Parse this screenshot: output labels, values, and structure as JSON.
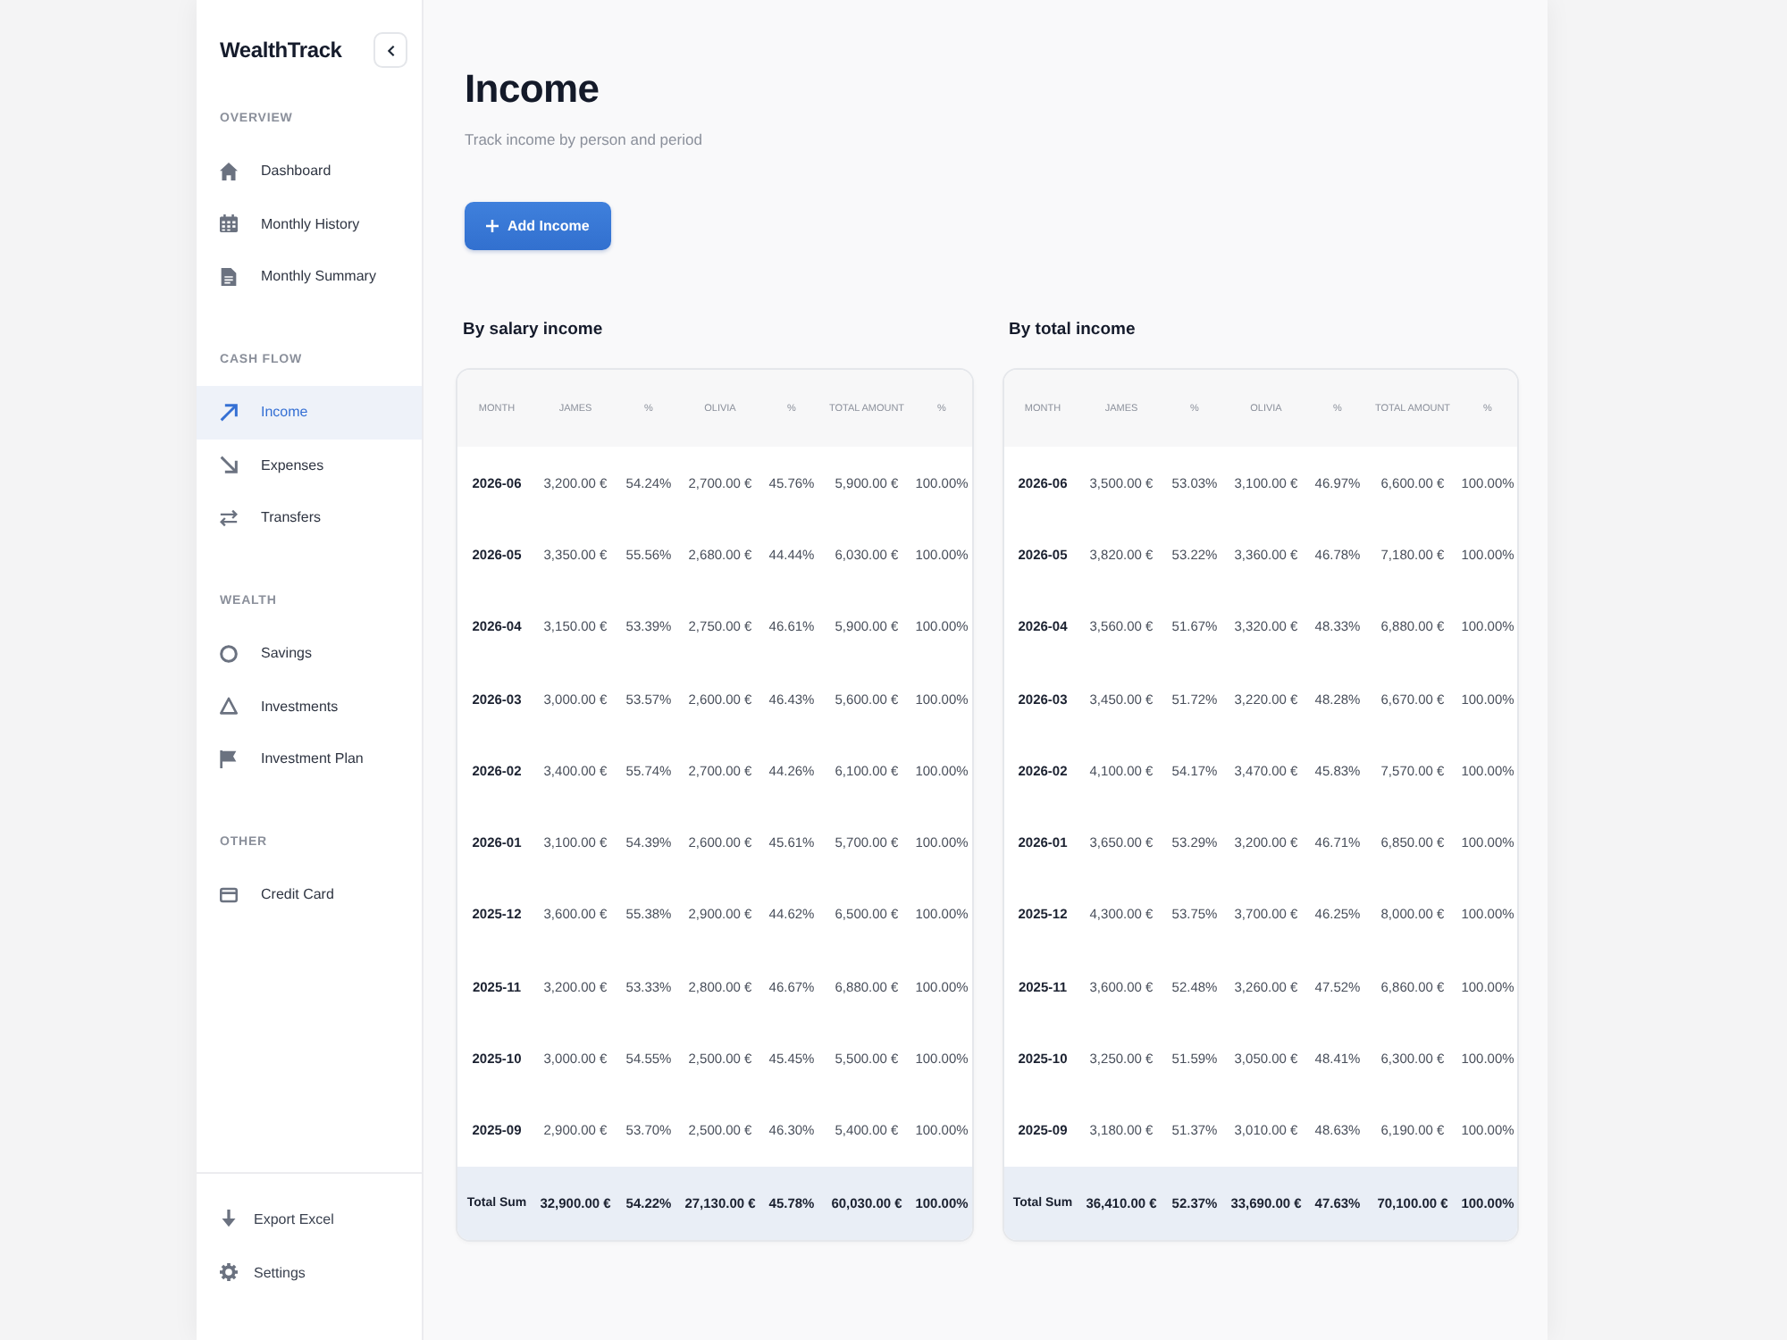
{
  "sidebar": {
    "brand": "WealthTrack",
    "sections": [
      {
        "label": "OVERVIEW",
        "items": [
          {
            "label": "Dashboard",
            "selected": false
          },
          {
            "label": "Monthly History",
            "selected": false
          },
          {
            "label": "Monthly Summary",
            "selected": false
          }
        ]
      },
      {
        "label": "CASH FLOW",
        "items": [
          {
            "label": "Income",
            "selected": true
          },
          {
            "label": "Expenses",
            "selected": false
          },
          {
            "label": "Transfers",
            "selected": false
          }
        ]
      },
      {
        "label": "WEALTH",
        "items": [
          {
            "label": "Savings",
            "selected": false
          },
          {
            "label": "Investments",
            "selected": false
          },
          {
            "label": "Investment Plan",
            "selected": false
          }
        ]
      },
      {
        "label": "OTHER",
        "items": [
          {
            "label": "Credit Card",
            "selected": false
          }
        ]
      }
    ],
    "footer_items": [
      {
        "label": "Export Excel"
      },
      {
        "label": "Settings"
      }
    ]
  },
  "header": {
    "title": "Income",
    "subtitle": "Track income by person and period",
    "add_button": "Add Income"
  },
  "tables": [
    {
      "title": "By salary income",
      "columns": [
        "MONTH",
        "JAMES",
        "%",
        "OLIVIA",
        "%",
        "TOTAL AMOUNT",
        "%"
      ],
      "rows": [
        [
          "2026-06",
          "3,200.00 €",
          "54.24%",
          "2,700.00 €",
          "45.76%",
          "5,900.00 €",
          "100.00%"
        ],
        [
          "2026-05",
          "3,350.00 €",
          "55.56%",
          "2,680.00 €",
          "44.44%",
          "6,030.00 €",
          "100.00%"
        ],
        [
          "2026-04",
          "3,150.00 €",
          "53.39%",
          "2,750.00 €",
          "46.61%",
          "5,900.00 €",
          "100.00%"
        ],
        [
          "2026-03",
          "3,000.00 €",
          "53.57%",
          "2,600.00 €",
          "46.43%",
          "5,600.00 €",
          "100.00%"
        ],
        [
          "2026-02",
          "3,400.00 €",
          "55.74%",
          "2,700.00 €",
          "44.26%",
          "6,100.00 €",
          "100.00%"
        ],
        [
          "2026-01",
          "3,100.00 €",
          "54.39%",
          "2,600.00 €",
          "45.61%",
          "5,700.00 €",
          "100.00%"
        ],
        [
          "2025-12",
          "3,600.00 €",
          "55.38%",
          "2,900.00 €",
          "44.62%",
          "6,500.00 €",
          "100.00%"
        ],
        [
          "2025-11",
          "3,200.00 €",
          "53.33%",
          "2,800.00 €",
          "46.67%",
          "6,880.00 €",
          "100.00%"
        ],
        [
          "2025-10",
          "3,000.00 €",
          "54.55%",
          "2,500.00 €",
          "45.45%",
          "5,500.00 €",
          "100.00%"
        ],
        [
          "2025-09",
          "2,900.00 €",
          "53.70%",
          "2,500.00 €",
          "46.30%",
          "5,400.00 €",
          "100.00%"
        ]
      ],
      "total_row": [
        "Total Sum",
        "32,900.00 €",
        "54.22%",
        "27,130.00 €",
        "45.78%",
        "60,030.00 €",
        "100.00%"
      ]
    },
    {
      "title": "By total income",
      "columns": [
        "MONTH",
        "JAMES",
        "%",
        "OLIVIA",
        "%",
        "TOTAL AMOUNT",
        "%"
      ],
      "rows": [
        [
          "2026-06",
          "3,500.00 €",
          "53.03%",
          "3,100.00 €",
          "46.97%",
          "6,600.00 €",
          "100.00%"
        ],
        [
          "2026-05",
          "3,820.00 €",
          "53.22%",
          "3,360.00 €",
          "46.78%",
          "7,180.00 €",
          "100.00%"
        ],
        [
          "2026-04",
          "3,560.00 €",
          "51.67%",
          "3,320.00 €",
          "48.33%",
          "6,880.00 €",
          "100.00%"
        ],
        [
          "2026-03",
          "3,450.00 €",
          "51.72%",
          "3,220.00 €",
          "48.28%",
          "6,670.00 €",
          "100.00%"
        ],
        [
          "2026-02",
          "4,100.00 €",
          "54.17%",
          "3,470.00 €",
          "45.83%",
          "7,570.00 €",
          "100.00%"
        ],
        [
          "2026-01",
          "3,650.00 €",
          "53.29%",
          "3,200.00 €",
          "46.71%",
          "6,850.00 €",
          "100.00%"
        ],
        [
          "2025-12",
          "4,300.00 €",
          "53.75%",
          "3,700.00 €",
          "46.25%",
          "8,000.00 €",
          "100.00%"
        ],
        [
          "2025-11",
          "3,600.00 €",
          "52.48%",
          "3,260.00 €",
          "47.52%",
          "6,860.00 €",
          "100.00%"
        ],
        [
          "2025-10",
          "3,250.00 €",
          "51.59%",
          "3,050.00 €",
          "48.41%",
          "6,300.00 €",
          "100.00%"
        ],
        [
          "2025-09",
          "3,180.00 €",
          "51.37%",
          "3,010.00 €",
          "48.63%",
          "6,190.00 €",
          "100.00%"
        ]
      ],
      "total_row": [
        "Total Sum",
        "36,410.00 €",
        "52.37%",
        "33,690.00 €",
        "47.63%",
        "70,100.00 €",
        "100.00%"
      ]
    }
  ]
}
